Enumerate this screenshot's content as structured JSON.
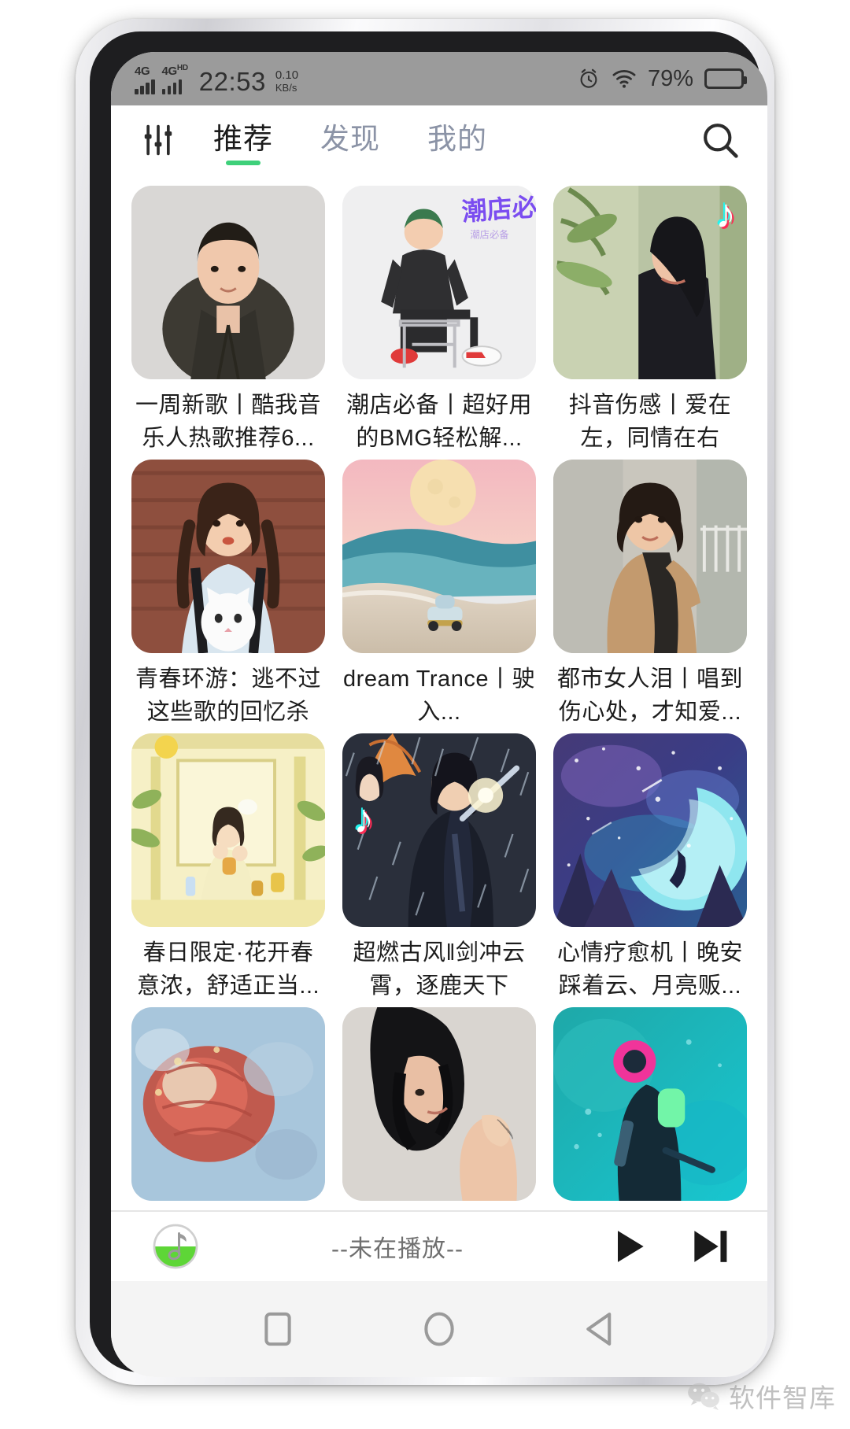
{
  "status_bar": {
    "network_a": "4G",
    "network_b": "4G",
    "network_b_sup": "HD",
    "time": "22:53",
    "net_rate": "0.10",
    "net_unit": "KB/s",
    "alarm_icon": "alarm-clock-icon",
    "wifi_icon": "wifi-icon",
    "battery_percent": "79%",
    "battery_level": 79
  },
  "header": {
    "equalizer_icon": "equalizer-icon",
    "search_icon": "search-icon",
    "active_tab_color": "#3ed07a",
    "tabs": [
      {
        "label": "推荐",
        "active": true
      },
      {
        "label": "发现",
        "active": false
      },
      {
        "label": "我的",
        "active": false
      }
    ]
  },
  "grid": {
    "cards": [
      {
        "title": "一周新歌丨酷我音乐人热歌推荐6...",
        "art": "portrait-man-suit",
        "badge": ""
      },
      {
        "title": "潮店必备丨超好用的BMG轻松解...",
        "art": "illustration-man-chair",
        "badge": ""
      },
      {
        "title": "抖音伤感丨爱在左，同情在右",
        "art": "photo-girl-plants",
        "badge": "tiktok-icon"
      },
      {
        "title": "青春环游：逃不过这些歌的回忆杀",
        "art": "photo-girl-cat",
        "badge": ""
      },
      {
        "title": "dream Trance丨驶入...",
        "art": "photo-car-moon-beach",
        "badge": ""
      },
      {
        "title": "都市女人泪丨唱到伤心处，才知爱...",
        "art": "photo-woman-coat",
        "badge": ""
      },
      {
        "title": "春日限定·花开春意浓，舒适正当...",
        "art": "illustration-yellow-room",
        "badge": ""
      },
      {
        "title": "超燃古风‖剑冲云霄，逐鹿天下",
        "art": "illustration-swordsman-rain",
        "badge": "tiktok-icon"
      },
      {
        "title": "心情疗愈机丨晚安踩着云、月亮贩...",
        "art": "illustration-moon-galaxy",
        "badge": ""
      },
      {
        "title": "",
        "art": "photo-red-coral",
        "badge": ""
      },
      {
        "title": "",
        "art": "photo-wet-hair-woman",
        "badge": ""
      },
      {
        "title": "",
        "art": "photo-teal-diver",
        "badge": ""
      }
    ]
  },
  "player": {
    "logo_icon": "music-note-logo-icon",
    "status_text": "--未在播放--",
    "play_icon": "play-icon",
    "next_icon": "next-track-icon"
  },
  "nav_bar": {
    "recents_icon": "square-recents-icon",
    "home_icon": "circle-home-icon",
    "back_icon": "triangle-back-icon"
  },
  "watermark": {
    "icon": "wechat-icon",
    "text": "软件智库"
  }
}
